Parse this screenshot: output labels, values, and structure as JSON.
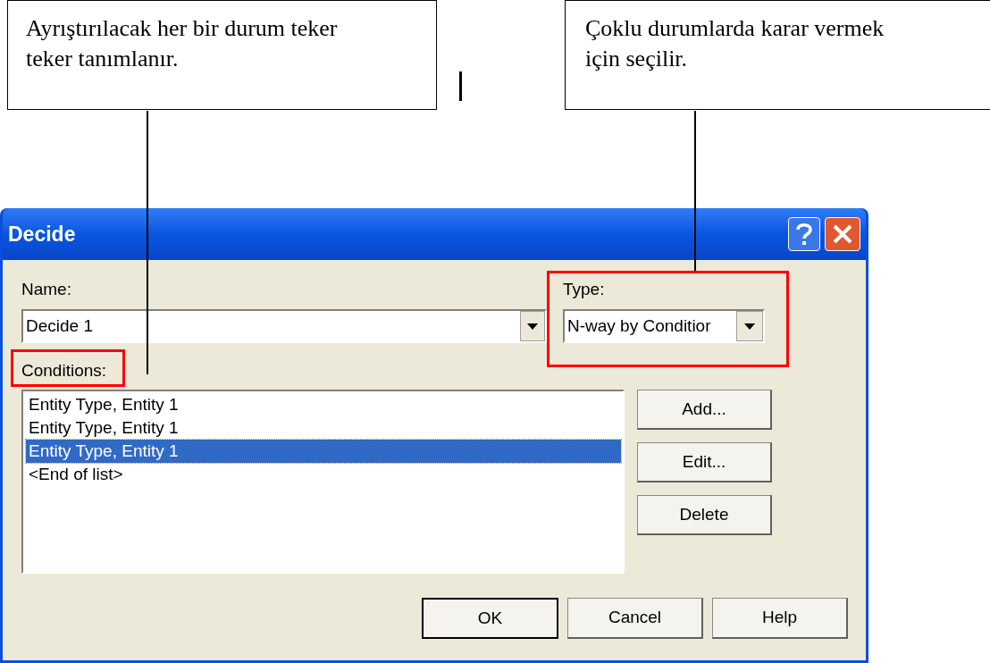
{
  "annotations": [
    {
      "text": "Ayrıştırılacak her bir durum teker teker tanımlanır."
    },
    {
      "text": "Çoklu durumlarda karar vermek için seçilir."
    }
  ],
  "dialog": {
    "title": "Decide",
    "name_label": "Name:",
    "name_value": "Decide 1",
    "type_label": "Type:",
    "type_value": "N-way by Conditior",
    "conditions_label": "Conditions:",
    "conditions": [
      {
        "text": "Entity Type, Entity 1",
        "selected": false
      },
      {
        "text": "Entity Type, Entity 1",
        "selected": false
      },
      {
        "text": "Entity Type, Entity 1",
        "selected": true
      },
      {
        "text": "<End of list>",
        "selected": false
      }
    ],
    "side_buttons": [
      "Add...",
      "Edit...",
      "Delete"
    ],
    "footer_buttons": [
      {
        "label": "OK",
        "kind": "default"
      },
      {
        "label": "Cancel",
        "kind": "normal"
      },
      {
        "label": "Help",
        "kind": "normal"
      }
    ]
  }
}
